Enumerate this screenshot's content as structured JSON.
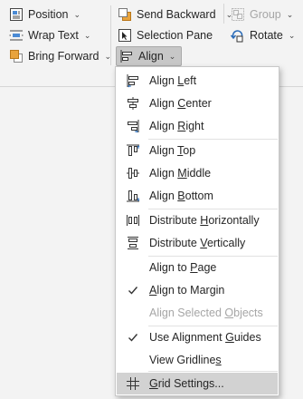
{
  "ribbon": {
    "position": {
      "label": "Position",
      "icon": "position-icon"
    },
    "wrap_text": {
      "label": "Wrap Text",
      "icon": "wrap-text-icon"
    },
    "bring_forward": {
      "label": "Bring Forward",
      "icon": "bring-forward-icon"
    },
    "send_backward": {
      "label": "Send Backward",
      "icon": "send-backward-icon"
    },
    "selection_pane": {
      "label": "Selection Pane",
      "icon": "selection-pane-icon"
    },
    "align": {
      "label": "Align",
      "icon": "align-icon"
    },
    "group": {
      "label": "Group",
      "icon": "group-icon",
      "disabled": true
    },
    "rotate": {
      "label": "Rotate",
      "icon": "rotate-icon"
    }
  },
  "align_menu": {
    "items": [
      {
        "pre": "Align ",
        "key": "L",
        "post": "eft",
        "icon": "align-left-icon"
      },
      {
        "pre": "Align ",
        "key": "C",
        "post": "enter",
        "icon": "align-center-icon"
      },
      {
        "pre": "Align ",
        "key": "R",
        "post": "ight",
        "icon": "align-right-icon"
      },
      {
        "pre": "Align ",
        "key": "T",
        "post": "op",
        "icon": "align-top-icon"
      },
      {
        "pre": "Align ",
        "key": "M",
        "post": "iddle",
        "icon": "align-middle-icon"
      },
      {
        "pre": "Align ",
        "key": "B",
        "post": "ottom",
        "icon": "align-bottom-icon"
      },
      {
        "pre": "Distribute ",
        "key": "H",
        "post": "orizontally",
        "icon": "distribute-horizontally-icon"
      },
      {
        "pre": "Distribute ",
        "key": "V",
        "post": "ertically",
        "icon": "distribute-vertically-icon"
      },
      {
        "pre": "Align to ",
        "key": "P",
        "post": "age",
        "checked": false
      },
      {
        "pre": "",
        "key": "A",
        "post": "lign to Margin",
        "checked": true
      },
      {
        "pre": "Align Selected ",
        "key": "O",
        "post": "bjects",
        "disabled": true
      },
      {
        "pre": "Use Alignment ",
        "key": "G",
        "post": "uides",
        "checked": true
      },
      {
        "pre": "View Gridline",
        "key": "s",
        "post": ""
      },
      {
        "pre": "",
        "key": "G",
        "post": "rid Settings...",
        "icon": "grid-icon",
        "hovered": true
      }
    ]
  },
  "colors": {
    "accent": "#2b6cb8",
    "icon_orange": "#e8a33d",
    "menu_hover": "#d2d2d2"
  }
}
